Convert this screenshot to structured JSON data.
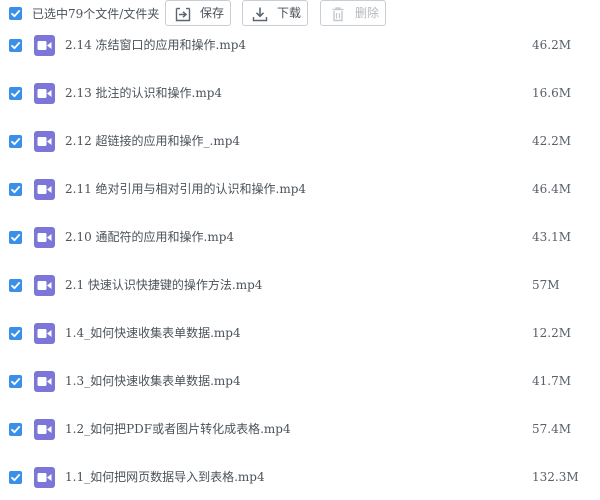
{
  "toolbar": {
    "selected_text": "已选中79个文件/文件夹",
    "save_label": "保存",
    "download_label": "下载",
    "delete_label": "删除"
  },
  "colors": {
    "checkbox": "#3b8fe6",
    "video_icon": "#7d76d9",
    "text": "#4b5259",
    "disabled_text": "#b4b9bf"
  },
  "files": [
    {
      "name": "2.14 冻结窗口的应用和操作.mp4",
      "size": "46.2M",
      "icon": "video-file-icon",
      "checked": true
    },
    {
      "name": "2.13 批注的认识和操作.mp4",
      "size": "16.6M",
      "icon": "video-file-icon",
      "checked": true
    },
    {
      "name": "2.12 超链接的应用和操作_.mp4",
      "size": "42.2M",
      "icon": "video-file-icon",
      "checked": true
    },
    {
      "name": "2.11 绝对引用与相对引用的认识和操作.mp4",
      "size": "46.4M",
      "icon": "video-file-icon",
      "checked": true
    },
    {
      "name": "2.10 通配符的应用和操作.mp4",
      "size": "43.1M",
      "icon": "video-file-icon",
      "checked": true
    },
    {
      "name": "2.1 快速认识快捷键的操作方法.mp4",
      "size": "57M",
      "icon": "video-file-icon",
      "checked": true
    },
    {
      "name": "1.4_如何快速收集表单数据.mp4",
      "size": "12.2M",
      "icon": "video-file-icon",
      "checked": true
    },
    {
      "name": "1.3_如何快速收集表单数据.mp4",
      "size": "41.7M",
      "icon": "video-file-icon",
      "checked": true
    },
    {
      "name": "1.2_如何把PDF或者图片转化成表格.mp4",
      "size": "57.4M",
      "icon": "video-file-icon",
      "checked": true
    },
    {
      "name": "1.1_如何把网页数据导入到表格.mp4",
      "size": "132.3M",
      "icon": "video-file-icon",
      "checked": true
    }
  ]
}
